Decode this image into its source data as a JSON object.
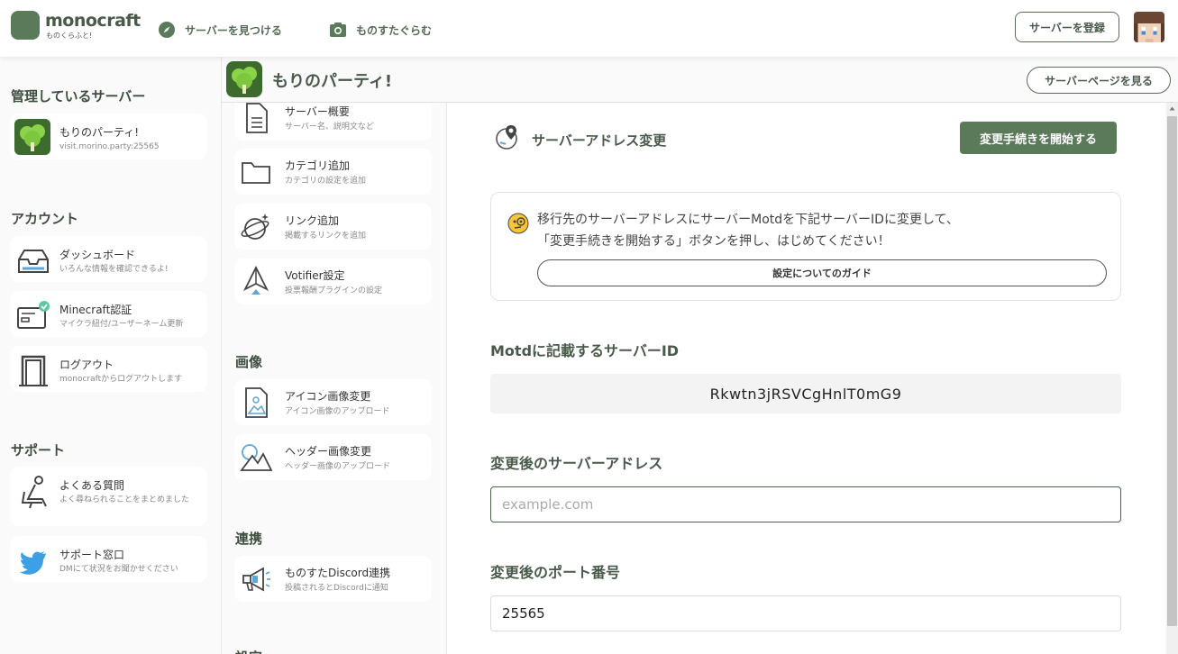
{
  "header": {
    "logo_name": "monocraft",
    "logo_sub": "ものくらふと!",
    "nav": [
      {
        "label": "サーバーを見つける",
        "icon": "compass-icon"
      },
      {
        "label": "ものすたぐらむ",
        "icon": "camera-icon"
      }
    ],
    "register_label": "サーバーを登録"
  },
  "sidebar": {
    "managed_heading": "管理しているサーバー",
    "server_card": {
      "title": "もりのパーティ!",
      "desc": "visit.morino.party:25565"
    },
    "account_heading": "アカウント",
    "account_items": [
      {
        "title": "ダッシュボード",
        "desc": "いろんな情報を確認できるよ!",
        "icon": "inbox-tray-icon"
      },
      {
        "title": "Minecraft認証",
        "desc": "マイクラ紐付/ユーザーネーム更新",
        "icon": "id-card-check-icon"
      },
      {
        "title": "ログアウト",
        "desc": "monocraftからログアウトします",
        "icon": "door-icon"
      }
    ],
    "support_heading": "サポート",
    "support_items": [
      {
        "title": "よくある質問",
        "desc": "よく尋ねられることをまとめました",
        "icon": "seat-icon"
      },
      {
        "title": "サポート窓口",
        "desc": "DMにて状況をお聞かせください",
        "icon": "twitter-bird-icon"
      }
    ]
  },
  "server_bar": {
    "title": "もりのパーティ!",
    "view_page_label": "サーバーページを見る"
  },
  "midmenu": {
    "items_top": [
      {
        "title": "サーバー概要",
        "desc": "サーバー名、説明文など",
        "icon": "document-icon"
      },
      {
        "title": "カテゴリ追加",
        "desc": "カテゴリの設定を追加",
        "icon": "folder-icon"
      },
      {
        "title": "リンク追加",
        "desc": "掲載するリンクを追加",
        "icon": "planet-link-icon"
      },
      {
        "title": "Votifier設定",
        "desc": "投票報酬プラグインの設定",
        "icon": "paper-plane-icon"
      }
    ],
    "image_heading": "画像",
    "image_items": [
      {
        "title": "アイコン画像変更",
        "desc": "アイコン画像のアップロード",
        "icon": "image-file-icon"
      },
      {
        "title": "ヘッダー画像変更",
        "desc": "ヘッダー画像のアップロード",
        "icon": "landscape-icon"
      }
    ],
    "link_heading": "連携",
    "link_items": [
      {
        "title": "ものすたDiscord連携",
        "desc": "投稿されるとDiscordに通知",
        "icon": "megaphone-icon"
      }
    ],
    "partial_heading": "設定"
  },
  "main": {
    "section_title": "サーバーアドレス変更",
    "start_label": "変更手続きを開始する",
    "info_line1": "移行先のサーバーアドレスにサーバーMotdを下記サーバーIDに変更して、",
    "info_line2": "「変更手続きを開始する」ボタンを押し、はじめてください！",
    "guide_label": "設定についてのガイド",
    "motd_label": "Motdに記載するサーバーID",
    "server_id": "Rkwtn3jRSVCgHnlT0mG9",
    "address_label": "変更後のサーバーアドレス",
    "address_placeholder": "example.com",
    "address_value": "",
    "port_label": "変更後のポート番号",
    "port_value": "25565"
  },
  "colors": {
    "accent": "#5a7a5a",
    "text_green": "#4a5a4a",
    "bg": "#fafafa"
  }
}
